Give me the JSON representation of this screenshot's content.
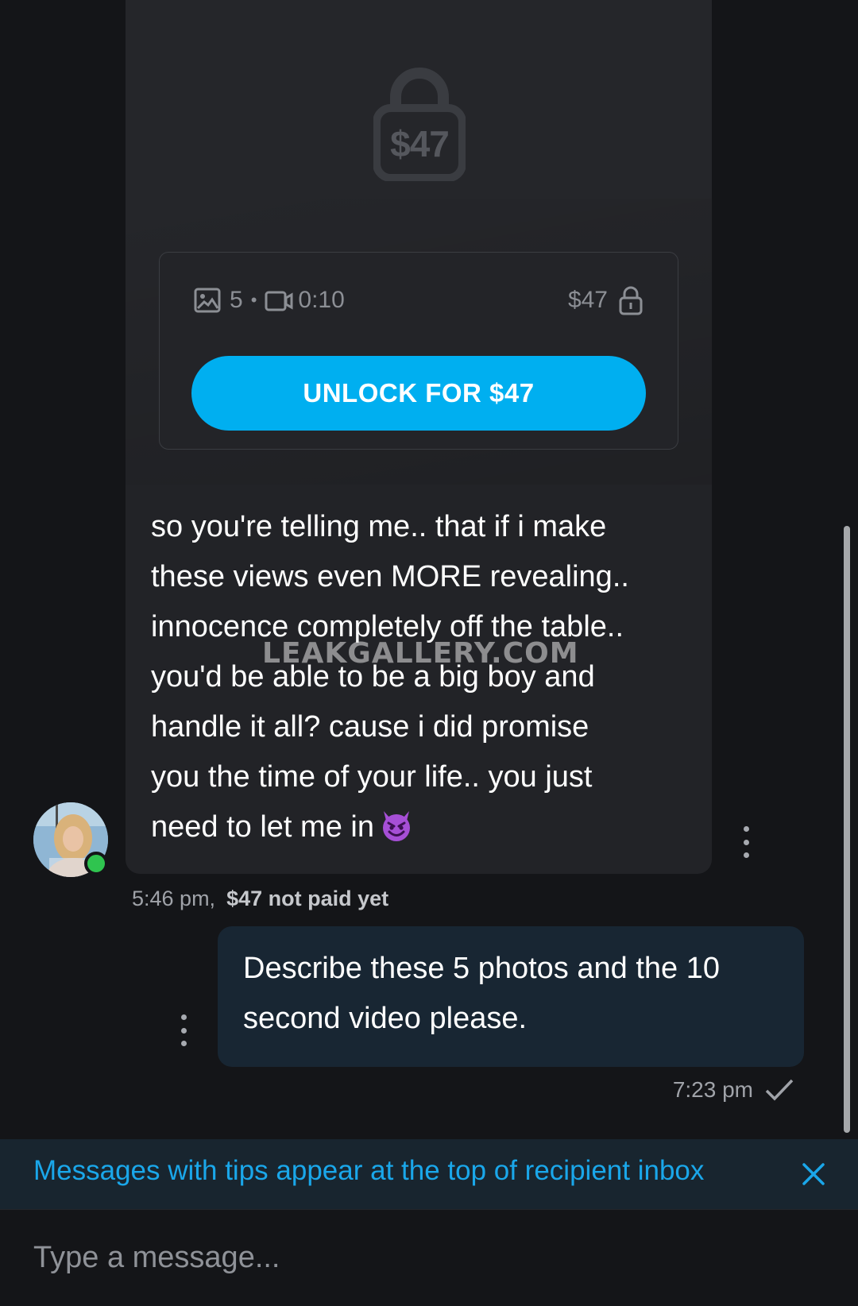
{
  "locked_post": {
    "preview_price": "$47",
    "photo_count": "5",
    "separator": "•",
    "video_duration": "0:10",
    "price": "$47",
    "unlock_label": "UNLOCK FOR $47"
  },
  "incoming_message": {
    "lines": [
      "so you're telling me.. that if i make",
      "these views even MORE revealing..",
      "innocence completely off the table..",
      "you'd be able to be a big boy and",
      "handle it all? cause i did promise",
      "you the time of your life.. you just",
      "need to let me in"
    ],
    "emoji": "smiling-face-with-horns",
    "time": "5:46 pm,",
    "payment_status": "$47 not paid yet",
    "sender_online": true
  },
  "watermark": "LEAKGALLERY.COM",
  "outgoing_message": {
    "lines": [
      "Describe these 5 photos and the 10",
      "second video please."
    ],
    "time": "7:23 pm",
    "status_icon": "checkmark-icon"
  },
  "tips_banner": {
    "text": "Messages with tips appear at the top of recipient inbox",
    "close_icon": "close-icon"
  },
  "composer": {
    "placeholder": "Type a message..."
  },
  "colors": {
    "accent": "#00aff0",
    "background": "#141518",
    "incoming_bubble": "#222327",
    "outgoing_bubble": "#182633",
    "online": "#2fc44f"
  }
}
